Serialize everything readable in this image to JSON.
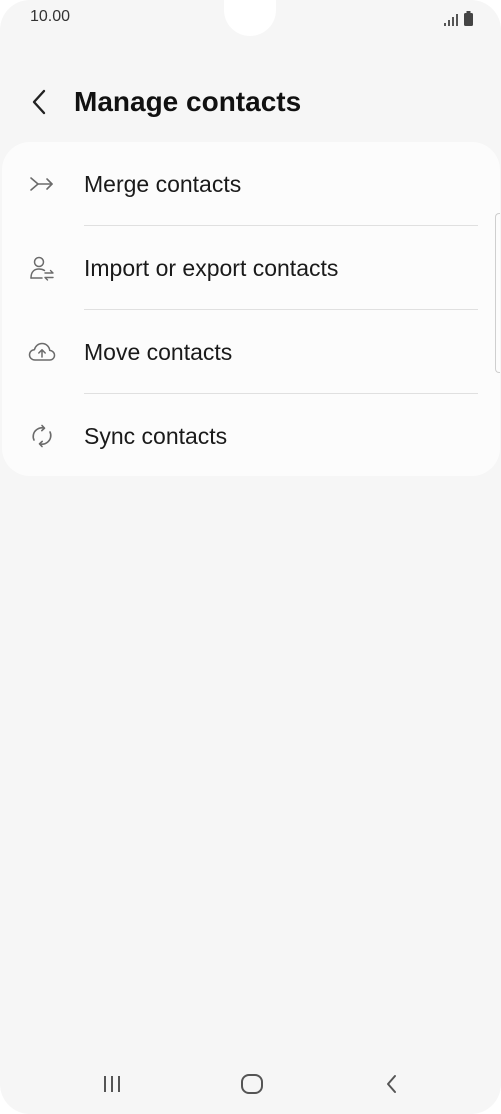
{
  "status_bar": {
    "time": "10.00",
    "icons": [
      "signal-icon",
      "battery-icon"
    ]
  },
  "header": {
    "back_icon": "chevron-left-icon",
    "title": "Manage contacts"
  },
  "menu": {
    "items": [
      {
        "icon": "merge-icon",
        "label": "Merge contacts"
      },
      {
        "icon": "person-swap-icon",
        "label": "Import or export contacts"
      },
      {
        "icon": "cloud-upload-icon",
        "label": "Move contacts"
      },
      {
        "icon": "sync-icon",
        "label": "Sync contacts"
      }
    ]
  },
  "nav_bar": {
    "buttons": [
      "recent-apps-icon",
      "home-icon",
      "back-icon"
    ]
  },
  "colors": {
    "background": "#f6f6f6",
    "card": "#fcfcfc",
    "text": "#111111",
    "icon": "#6b6b6b",
    "divider": "#e0e0e0"
  }
}
